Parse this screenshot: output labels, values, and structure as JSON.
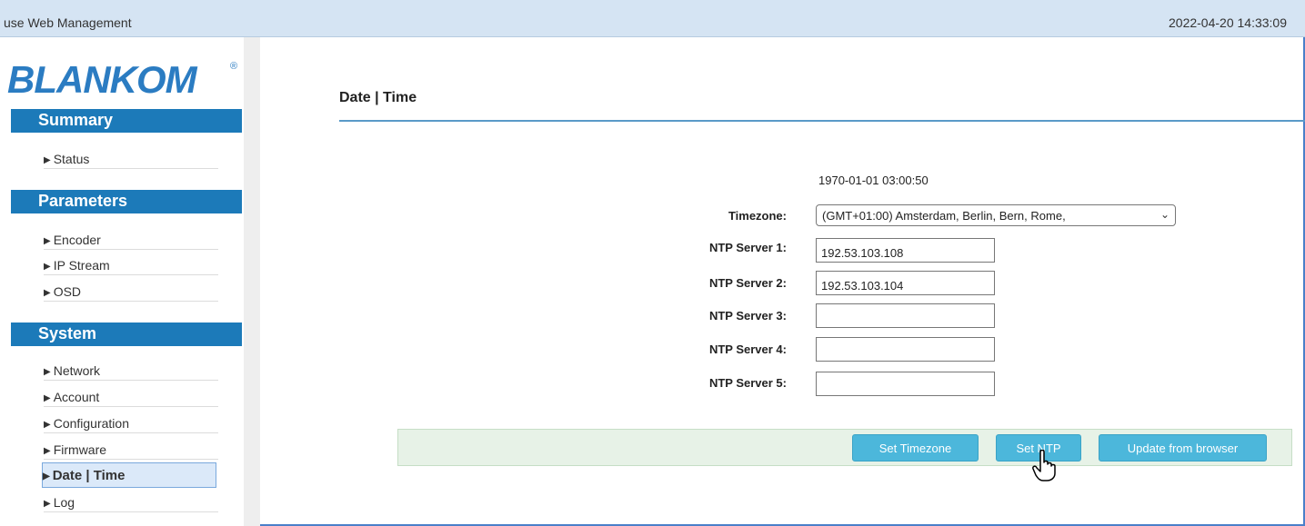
{
  "header": {
    "title": "use Web Management",
    "datetime": "2022-04-20 14:33:09"
  },
  "logo": {
    "text": "BLANKOM",
    "registered": "®"
  },
  "sidebar": {
    "sections": [
      {
        "label": "Summary",
        "items": [
          {
            "label": "Status"
          }
        ]
      },
      {
        "label": "Parameters",
        "items": [
          {
            "label": "Encoder"
          },
          {
            "label": "IP Stream"
          },
          {
            "label": "OSD"
          }
        ]
      },
      {
        "label": "System",
        "items": [
          {
            "label": "Network"
          },
          {
            "label": "Account"
          },
          {
            "label": "Configuration"
          },
          {
            "label": "Firmware"
          },
          {
            "label": "Date | Time",
            "active": true
          },
          {
            "label": "Log"
          }
        ]
      }
    ]
  },
  "main": {
    "title": "Date | Time",
    "current_time": "1970-01-01 03:00:50",
    "timezone_label": "Timezone:",
    "timezone_value": "(GMT+01:00) Amsterdam, Berlin, Bern, Rome,",
    "ntp": [
      {
        "label": "NTP Server 1:",
        "value": "192.53.103.108"
      },
      {
        "label": "NTP Server 2:",
        "value": "192.53.103.104"
      },
      {
        "label": "NTP Server 3:",
        "value": ""
      },
      {
        "label": "NTP Server 4:",
        "value": ""
      },
      {
        "label": "NTP Server 5:",
        "value": ""
      }
    ],
    "buttons": {
      "set_timezone": "Set Timezone",
      "set_ntp": "Set NTP",
      "update_browser": "Update from browser"
    }
  },
  "colors": {
    "accent": "#1c7ab9",
    "header_bg": "#d5e4f3",
    "button": "#4cb7db",
    "button_bar": "#e7f2e7"
  }
}
